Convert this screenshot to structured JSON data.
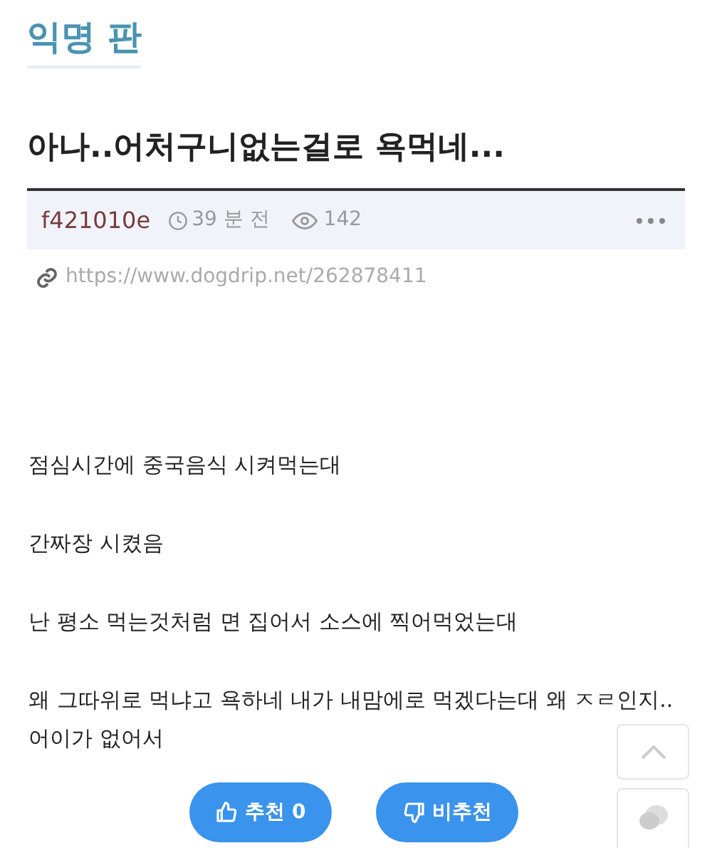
{
  "board": {
    "title": "익명 판"
  },
  "post": {
    "title": "아나..어처구니없는걸로 욕먹네...",
    "author": "f421010e",
    "time": "39 분 전",
    "views": "142",
    "url": "https://www.dogdrip.net/262878411"
  },
  "body": [
    [
      "점심시간에 중국음식 시켜먹는대"
    ],
    [
      "간짜장 시켰음"
    ],
    [
      "난 평소 먹는것처럼 면 집어서 소스에 찍어먹었는대"
    ],
    [
      "왜 그따위로 먹냐고 욕하네 내가 내맘에로 먹겠다는대 왜 ㅈㄹ인지..",
      "어이가 없어서"
    ]
  ],
  "votes": [
    {
      "kind": "up",
      "label": "추천 0"
    },
    {
      "kind": "down",
      "label": "비추천"
    }
  ]
}
